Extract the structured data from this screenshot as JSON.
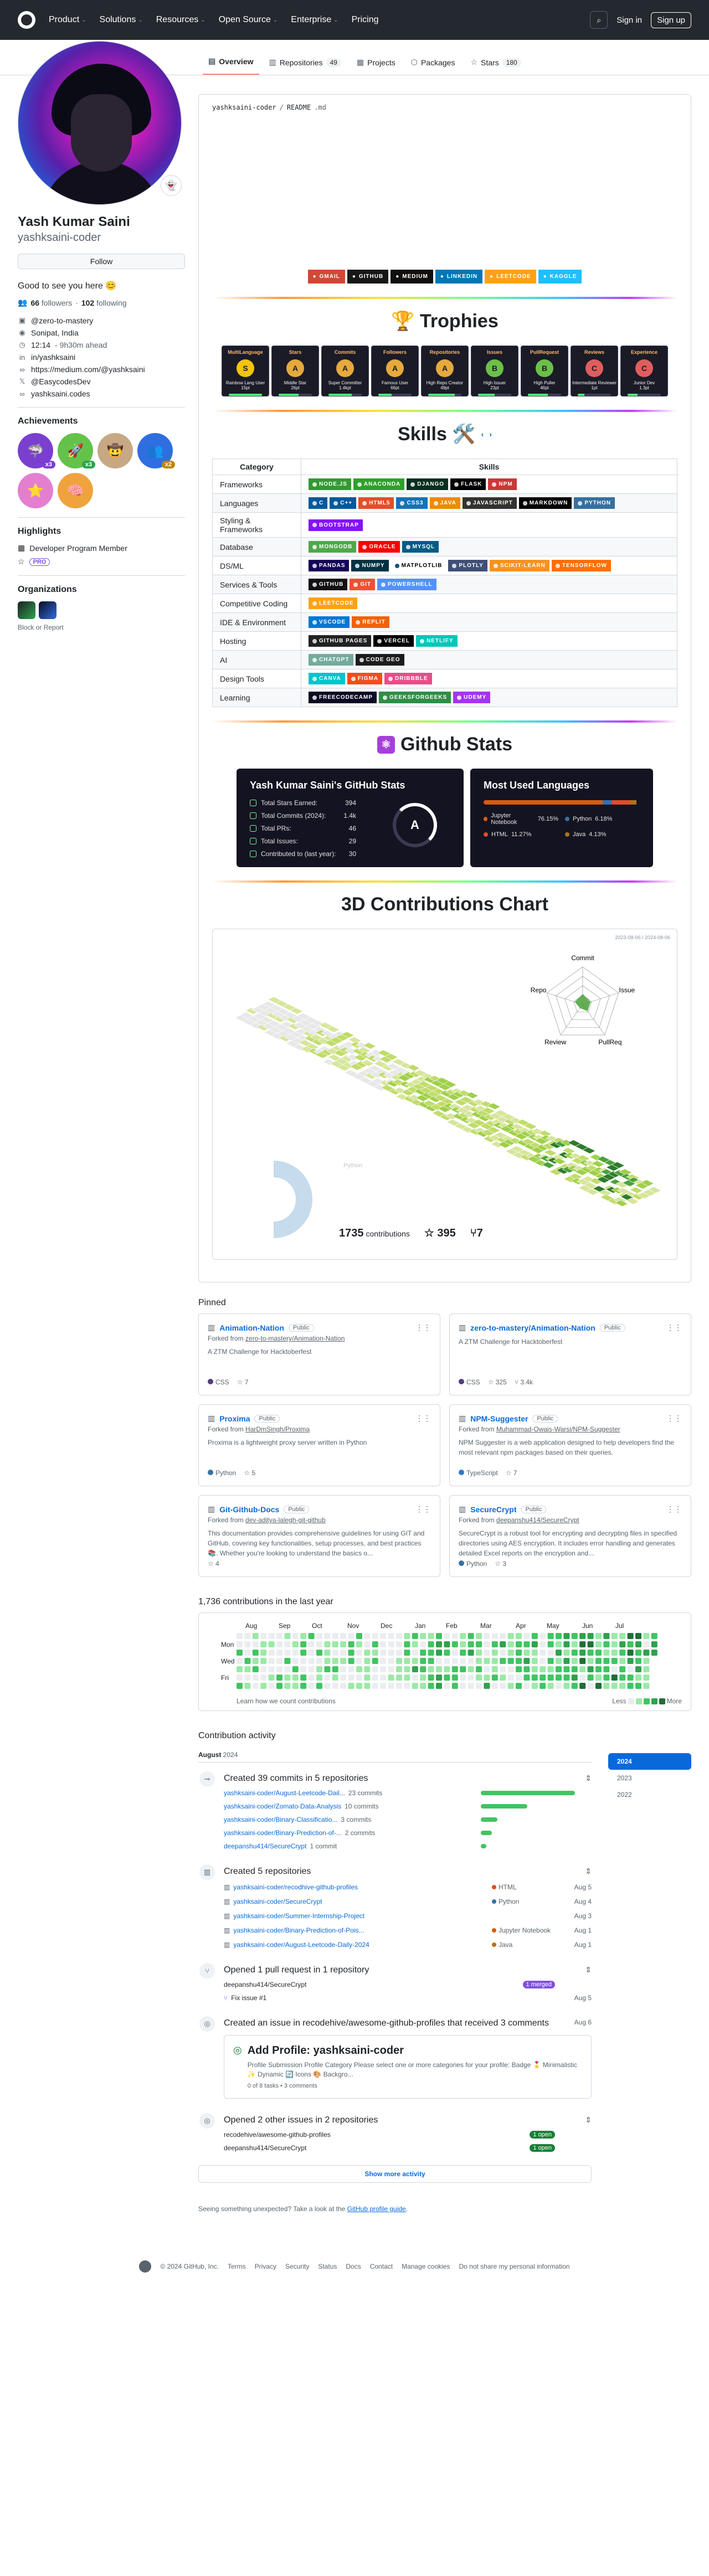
{
  "header": {
    "nav": [
      "Product",
      "Solutions",
      "Resources",
      "Open Source",
      "Enterprise",
      "Pricing"
    ],
    "sign_in": "Sign in",
    "sign_up": "Sign up"
  },
  "tabs": [
    {
      "label": "Overview",
      "count": "",
      "icon": "book-icon",
      "glyph": "▤"
    },
    {
      "label": "Repositories",
      "count": "49",
      "icon": "repo-icon",
      "glyph": "▥"
    },
    {
      "label": "Projects",
      "count": "",
      "icon": "table-icon",
      "glyph": "▦"
    },
    {
      "label": "Packages",
      "count": "",
      "icon": "package-icon",
      "glyph": "⬡"
    },
    {
      "label": "Stars",
      "count": "180",
      "icon": "star-icon",
      "glyph": "☆"
    }
  ],
  "profile": {
    "name": "Yash Kumar Saini",
    "username": "yashksaini-coder",
    "follow": "Follow",
    "bio": "Good to see you here 😊",
    "followers_count": "66",
    "followers_label": "followers",
    "following_count": "102",
    "following_label": "following",
    "details": [
      {
        "icon": "organization-icon",
        "glyph": "▣",
        "text": "@zero-to-mastery",
        "muted": ""
      },
      {
        "icon": "location-icon",
        "glyph": "◉",
        "text": "Sonipat, India",
        "muted": ""
      },
      {
        "icon": "clock-icon",
        "glyph": "◷",
        "text": "12:14",
        "muted": " - 9h30m ahead"
      },
      {
        "icon": "linkedin-icon",
        "glyph": "in",
        "text": "in/yashksaini",
        "muted": ""
      },
      {
        "icon": "link-icon",
        "glyph": "∞",
        "text": "https://medium.com/@yashksaini",
        "muted": ""
      },
      {
        "icon": "x-icon",
        "glyph": "𝕏",
        "text": "@EasycodesDev",
        "muted": ""
      },
      {
        "icon": "link-icon",
        "glyph": "∞",
        "text": "yashksaini.codes",
        "muted": ""
      }
    ]
  },
  "achievements": {
    "title": "Achievements",
    "badges": [
      {
        "name": "achievement-pull-shark",
        "glyph": "🦈",
        "color": "#7b3fd0",
        "count": "x3",
        "count_color": "#7b3fd0"
      },
      {
        "name": "achievement-yolo",
        "glyph": "🚀",
        "color": "#64c24b",
        "count": "x3",
        "count_color": "#2da44e"
      },
      {
        "name": "achievement-quickdraw",
        "glyph": "🤠",
        "color": "#c7a884",
        "count": "",
        "count_color": ""
      },
      {
        "name": "achievement-pair-extraordinaire",
        "glyph": "👥",
        "color": "#2f6ee0",
        "count": "x2",
        "count_color": "#bf8700"
      },
      {
        "name": "achievement-starstruck",
        "glyph": "⭐",
        "color": "#e47fd0",
        "count": "",
        "count_color": ""
      },
      {
        "name": "achievement-galaxy-brain",
        "glyph": "🧠",
        "color": "#f0a33c",
        "count": "",
        "count_color": ""
      }
    ]
  },
  "highlights": {
    "title": "Highlights",
    "program": "Developer Program Member",
    "pro": "PRO"
  },
  "organizations": {
    "title": "Organizations",
    "block": "Block or Report"
  },
  "readme": {
    "path_user": "yashksaini-coder",
    "path_file": "README",
    "path_ext": ".md",
    "contact_badges": [
      {
        "label": "GMAIL",
        "color": "#d14836",
        "icon": "gmail-icon"
      },
      {
        "label": "GITHUB",
        "color": "#181717",
        "icon": "github-icon"
      },
      {
        "label": "MEDIUM",
        "color": "#12100e",
        "icon": "medium-icon"
      },
      {
        "label": "LINKEDIN",
        "color": "#0077b5",
        "icon": "linkedin-icon"
      },
      {
        "label": "LEETCODE",
        "color": "#ffa116",
        "icon": "leetcode-icon"
      },
      {
        "label": "KAGGLE",
        "color": "#20beff",
        "icon": "kaggle-icon"
      }
    ],
    "trophies_title": "🏆 Trophies",
    "trophies": [
      {
        "title": "MultiLanguage",
        "rank": "S",
        "sub": "Rainbow Lang User\n15pt",
        "color": "#f1c40f",
        "progress": 1.0
      },
      {
        "title": "Stars",
        "rank": "A",
        "sub": "Middle Star\n26pt",
        "color": "#e6a93c",
        "progress": 0.6
      },
      {
        "title": "Commits",
        "rank": "A",
        "sub": "Super Committer\n1.4kpt",
        "color": "#e6a93c",
        "progress": 0.7
      },
      {
        "title": "Followers",
        "rank": "A",
        "sub": "Famous User\n66pt",
        "color": "#e6a93c",
        "progress": 0.4
      },
      {
        "title": "Repositories",
        "rank": "A",
        "sub": "High Repo Creator\n49pt",
        "color": "#e6a93c",
        "progress": 0.8
      },
      {
        "title": "Issues",
        "rank": "B",
        "sub": "High Issuer\n23pt",
        "color": "#6cc04a",
        "progress": 0.5
      },
      {
        "title": "PullRequest",
        "rank": "B",
        "sub": "High Puller\n46pt",
        "color": "#6cc04a",
        "progress": 0.6
      },
      {
        "title": "Reviews",
        "rank": "C",
        "sub": "Intermediate Reviewer\n1pt",
        "color": "#e05d5d",
        "progress": 0.2
      },
      {
        "title": "Experience",
        "rank": "C",
        "sub": "Junior Dev\n1.3pt",
        "color": "#e05d5d",
        "progress": 0.3
      }
    ],
    "skills_title": "Skills 🛠️",
    "skills_table": {
      "headers": [
        "Category",
        "Skills"
      ],
      "rows": [
        {
          "category": "Frameworks",
          "badges": [
            {
              "label": "NODE.JS",
              "color": "#339933"
            },
            {
              "label": "ANACONDA",
              "color": "#2ea02b"
            },
            {
              "label": "DJANGO",
              "color": "#092e20"
            },
            {
              "label": "FLASK",
              "color": "#000000"
            },
            {
              "label": "NPM",
              "color": "#cb3837"
            }
          ]
        },
        {
          "category": "Languages",
          "badges": [
            {
              "label": "C",
              "color": "#00599c"
            },
            {
              "label": "C++",
              "color": "#00599c"
            },
            {
              "label": "HTML5",
              "color": "#e34f26"
            },
            {
              "label": "CSS3",
              "color": "#1572b6"
            },
            {
              "label": "JAVA",
              "color": "#ed8b00"
            },
            {
              "label": "JAVASCRIPT",
              "color": "#323330"
            },
            {
              "label": "MARKDOWN",
              "color": "#000000"
            },
            {
              "label": "PYTHON",
              "color": "#3670a0"
            }
          ]
        },
        {
          "category": "Styling & Frameworks",
          "badges": [
            {
              "label": "BOOTSTRAP",
              "color": "#8511fa"
            }
          ]
        },
        {
          "category": "Database",
          "badges": [
            {
              "label": "MONGODB",
              "color": "#4ea94b"
            },
            {
              "label": "ORACLE",
              "color": "#f80000"
            },
            {
              "label": "MYSQL",
              "color": "#005c84"
            }
          ]
        },
        {
          "category": "DS/ML",
          "badges": [
            {
              "label": "PANDAS",
              "color": "#150458"
            },
            {
              "label": "NUMPY",
              "color": "#013243"
            },
            {
              "label": "MATPLOTLIB",
              "color": "#ffffff"
            },
            {
              "label": "PLOTLY",
              "color": "#3f4f75"
            },
            {
              "label": "SCIKIT-LEARN",
              "color": "#f7931e"
            },
            {
              "label": "TENSORFLOW",
              "color": "#ff6f00"
            }
          ]
        },
        {
          "category": "Services & Tools",
          "badges": [
            {
              "label": "GITHUB",
              "color": "#121011"
            },
            {
              "label": "GIT",
              "color": "#f05033"
            },
            {
              "label": "POWERSHELL",
              "color": "#5391fe"
            }
          ]
        },
        {
          "category": "Competitive Coding",
          "badges": [
            {
              "label": "LEETCODE",
              "color": "#ffa116"
            }
          ]
        },
        {
          "category": "IDE & Environment",
          "badges": [
            {
              "label": "VSCODE",
              "color": "#0078d4"
            },
            {
              "label": "REPLIT",
              "color": "#f26207"
            }
          ]
        },
        {
          "category": "Hosting",
          "badges": [
            {
              "label": "GITHUB PAGES",
              "color": "#222222"
            },
            {
              "label": "VERCEL",
              "color": "#000000"
            },
            {
              "label": "NETLIFY",
              "color": "#00c7b7"
            }
          ]
        },
        {
          "category": "AI",
          "badges": [
            {
              "label": "CHATGPT",
              "color": "#74aa9c"
            },
            {
              "label": "Code Geo",
              "color": "#1c1c1c"
            }
          ]
        },
        {
          "category": "Design Tools",
          "badges": [
            {
              "label": "CANVA",
              "color": "#00c4cc"
            },
            {
              "label": "FIGMA",
              "color": "#f24e1e"
            },
            {
              "label": "DRIBBBLE",
              "color": "#ea4c89"
            }
          ]
        },
        {
          "category": "Learning",
          "badges": [
            {
              "label": "FREECODECAMP",
              "color": "#0a0a23"
            },
            {
              "label": "GEEKSFORGEEKS",
              "color": "#2f8d46"
            },
            {
              "label": "UDEMY",
              "color": "#a435f0"
            }
          ]
        }
      ]
    },
    "github_stats_title": "Github Stats",
    "stats_card": {
      "title": "Yash Kumar Saini's GitHub Stats",
      "rank": "A",
      "lines": [
        {
          "label": "Total Stars Earned:",
          "value": "394"
        },
        {
          "label": "Total Commits (2024):",
          "value": "1.4k"
        },
        {
          "label": "Total PRs:",
          "value": "46"
        },
        {
          "label": "Total Issues:",
          "value": "29"
        },
        {
          "label": "Contributed to (last year):",
          "value": "30"
        }
      ]
    },
    "lang_card": {
      "title": "Most Used Languages",
      "langs": [
        {
          "name": "Jupyter Notebook",
          "pct": "76.15%",
          "value": 76.15,
          "color": "#da5b0b"
        },
        {
          "name": "Python",
          "pct": "6.18%",
          "value": 6.18,
          "color": "#3572a5"
        },
        {
          "name": "HTML",
          "pct": "11.27%",
          "value": 11.27,
          "color": "#e34c26"
        },
        {
          "name": "Java",
          "pct": "4.13%",
          "value": 4.13,
          "color": "#b07219"
        }
      ]
    },
    "contrib_title": "3D Contributions Chart",
    "contrib_card": {
      "date_range": "2023-08-06 / 2024-08-06",
      "radar_labels": [
        "Commit",
        "Issue",
        "PullReq",
        "Review",
        "Repo"
      ],
      "pie_label": "Python",
      "total_contributions": "1735",
      "contributions_label": "contributions",
      "stars": "395",
      "forks": "7"
    }
  },
  "pinned": {
    "title": "Pinned",
    "items": [
      {
        "name": "Animation-Nation",
        "visibility": "Public",
        "forked_from": "",
        "forked_src": "zero-to-mastery/Animation-Nation",
        "forked_label": "Forked from",
        "desc": "A ZTM Challenge for Hacktoberfest",
        "lang": "CSS",
        "lang_color": "#563d7c",
        "stars": "7",
        "forks": ""
      },
      {
        "name": "zero-to-mastery/Animation-Nation",
        "visibility": "Public",
        "forked_from": "",
        "forked_src": "",
        "forked_label": "",
        "desc": "A ZTM Challenge for Hacktoberfest",
        "lang": "CSS",
        "lang_color": "#563d7c",
        "stars": "325",
        "forks": "3.4k"
      },
      {
        "name": "Proxima",
        "visibility": "Public",
        "forked_label": "Forked from",
        "forked_src": "HarDmSingh/Proxima",
        "desc": "Proxima is a lightweight proxy server written in Python",
        "lang": "Python",
        "lang_color": "#3572a5",
        "stars": "5",
        "forks": ""
      },
      {
        "name": "NPM-Suggester",
        "visibility": "Public",
        "forked_label": "Forked from",
        "forked_src": "Muhammad-Owais-Warsi/NPM-Suggester",
        "desc": "NPM Suggester is a web application designed to help developers find the most relevant npm packages based on their queries.",
        "lang": "TypeScript",
        "lang_color": "#3178c6",
        "stars": "7",
        "forks": ""
      },
      {
        "name": "Git-Github-Docs",
        "visibility": "Public",
        "forked_label": "Forked from",
        "forked_src": "dev-aditya-lalegh-git-github",
        "desc": "This documentation provides comprehensive guidelines for using GIT and GitHub, covering key functionalities, setup processes, and best practices 📚. Whether you're looking to understand the basics o...",
        "lang": "",
        "lang_color": "",
        "stars": "4",
        "forks": ""
      },
      {
        "name": "SecureCrypt",
        "visibility": "Public",
        "forked_label": "Forked from",
        "forked_src": "deepanshu414/SecureCrypt",
        "desc": "SecureCrypt is a robust tool for encrypting and decrypting files in specified directories using AES encryption. It includes error handling and generates detailed Excel reports on the encryption and...",
        "lang": "Python",
        "lang_color": "#3572a5",
        "stars": "3",
        "forks": ""
      }
    ]
  },
  "calendar": {
    "title": "1,736 contributions in the last year",
    "months": [
      "Aug",
      "Sep",
      "Oct",
      "Nov",
      "Dec",
      "Jan",
      "Feb",
      "Mar",
      "Apr",
      "May",
      "Jun",
      "Jul"
    ],
    "days": [
      "Mon",
      "Wed",
      "Fri"
    ],
    "learn": "Learn how we count contributions",
    "less": "Less",
    "more": "More",
    "colors": [
      "#ebedf0",
      "#9be9a8",
      "#40c463",
      "#30a14e",
      "#216e39"
    ]
  },
  "activity": {
    "title": "Contribution activity",
    "month": "August",
    "year": "2024",
    "years": [
      "2024",
      "2023",
      "2022"
    ],
    "commits": {
      "title": "Created 39 commits in 5 repositories",
      "rows": [
        {
          "repo": "yashksaini-coder/August-Leetcode-Dail...",
          "count": "23 commits",
          "share": 0.85
        },
        {
          "repo": "yashksaini-coder/Zomato-Data-Analysis",
          "count": "10 commits",
          "share": 0.42
        },
        {
          "repo": "yashksaini-coder/Binary-Classificatio...",
          "count": "3 commits",
          "share": 0.15
        },
        {
          "repo": "yashksaini-coder/Binary-Prediction-of-...",
          "count": "2 commits",
          "share": 0.1
        },
        {
          "repo": "deepanshu414/SecureCrypt",
          "count": "1 commit",
          "share": 0.05
        }
      ]
    },
    "repos": {
      "title": "Created 5 repositories",
      "rows": [
        {
          "repo": "yashksaini-coder/recodhive-github-profiles",
          "lang": "HTML",
          "lang_color": "#e34c26",
          "date": "Aug 5"
        },
        {
          "repo": "yashksaini-coder/SecureCrypt",
          "lang": "Python",
          "lang_color": "#3572a5",
          "date": "Aug 4"
        },
        {
          "repo": "yashksaini-coder/Summer-Internship-Project",
          "lang": "",
          "lang_color": "",
          "date": "Aug 3"
        },
        {
          "repo": "yashksaini-coder/Binary-Prediction-of-Pois...",
          "lang": "Jupyter Notebook",
          "lang_color": "#da5b0b",
          "date": "Aug 1"
        },
        {
          "repo": "yashksaini-coder/August-Leetcode-Daily-2024",
          "lang": "Java",
          "lang_color": "#b07219",
          "date": "Aug 1"
        }
      ]
    },
    "prs": {
      "title": "Opened 1 pull request in 1 repository",
      "repo": "deepanshu414/SecureCrypt",
      "repo_count": "1",
      "repo_state": "merged",
      "pr": "Fix issue #1",
      "state": "merged",
      "date": "Aug 5"
    },
    "issue_created": {
      "title": "Created an issue in recodehive/awesome-github-profiles that received 3 comments",
      "date": "Aug 6",
      "card_title": "Add Profile: yashksaini-coder",
      "card_body": "Profile Submission Profile Category Please select one or more categories for your profile: Badge 🎖️ Minimalistic ✨ Dynamic 🔄 Icons 🎨 Backgro...",
      "card_meta": "0 of 8 tasks • 3 comments"
    },
    "other_issues": {
      "title": "Opened 2 other issues in 2 repositories",
      "rows": [
        {
          "repo": "recodehive/awesome-github-profiles",
          "count": "1",
          "state": "open"
        },
        {
          "repo": "deepanshu414/SecureCrypt",
          "count": "1",
          "state": "open"
        }
      ]
    },
    "show_more": "Show more activity",
    "unexpected": "Seeing something unexpected? Take a look at the ",
    "guide": "GitHub profile guide",
    "guide_end": "."
  },
  "footer": {
    "copyright": "© 2024 GitHub, Inc.",
    "links": [
      "Terms",
      "Privacy",
      "Security",
      "Status",
      "Docs",
      "Contact",
      "Manage cookies",
      "Do not share my personal information"
    ]
  }
}
